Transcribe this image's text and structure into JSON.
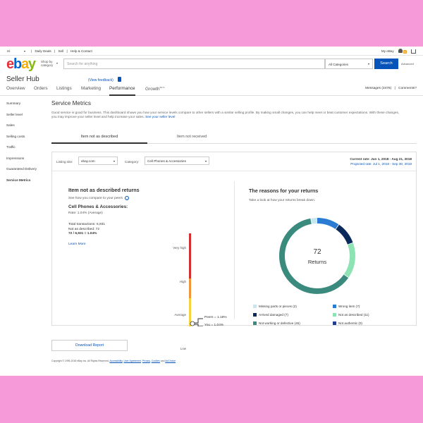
{
  "topbar": {
    "greeting": "Hi",
    "links": [
      "Daily Deals",
      "Sell",
      "Help & Contact"
    ],
    "separator": "|",
    "my_ebay": "My eBay",
    "notifications_count": "5"
  },
  "header": {
    "logo": {
      "e": "e",
      "b": "b",
      "a": "a",
      "y": "y"
    },
    "shop_by": "Shop by category",
    "search_placeholder": "Search for anything",
    "category_value": "All Categories",
    "search_button": "Search",
    "advanced": "Advanced"
  },
  "hub": {
    "title": "Seller Hub",
    "feedback": "(View feedback)",
    "nav": [
      "Overview",
      "Orders",
      "Listings",
      "Marketing",
      "Performance",
      "Growth"
    ],
    "growth_badge": "BETA",
    "messages": "Messages (3476)",
    "comments": "Comments?"
  },
  "sidebar": [
    "Summary",
    "Seller level",
    "Sales",
    "Selling costs",
    "Traffic",
    "Impressions",
    "Guaranteed Delivery",
    "Service Metrics"
  ],
  "main": {
    "title": "Service Metrics",
    "description": "Good service is good for business. This dashboard shows you how your service levels compare to other sellers with a similar selling profile. By making small changes, you can help meet or beat customer expectations. With these changes, you may improve your seller level and help increase your sales.",
    "description_link": "See your seller level",
    "tabs": [
      "Item not as described",
      "Item not received"
    ]
  },
  "filters": {
    "listing_site_label": "Listing site:",
    "listing_site_value": "ebay.com",
    "category_label": "Category:",
    "category_value": "Cell Phones & Accessories",
    "current_rate": "Current rate: Jun 1, 2018 - Aug 21, 2018",
    "projected_rate": "Projected rate: Jul 1, 2018 - Sep 30, 2018"
  },
  "returns": {
    "title": "Item not as described returns",
    "subtitle": "See how you compare to your peers",
    "category": "Cell Phones & Accessories:",
    "rate": "Rate: 1.04% (Average)",
    "total": "Total transactions: 6,931",
    "not_described": "Not as described: 72",
    "ratio": "72 / 6,931 = 1.04%",
    "learn_more": "Learn More",
    "scale": [
      "Very high",
      "High",
      "Average",
      "Low"
    ],
    "peers": "Peers = 1.18%",
    "you": "You = 1.04%",
    "scale_colors": {
      "very_high": "#d32f2f",
      "high": "#f0953a",
      "average": "#f5d33f",
      "low": "#5cb85c"
    }
  },
  "reasons": {
    "title": "The reasons for your returns",
    "subtitle": "Take a look at how your returns break down.",
    "total": "72",
    "total_label": "Returns",
    "items": [
      {
        "label": "Missing parts or pieces (2)",
        "value": 2,
        "color": "#c9e6f0"
      },
      {
        "label": "Wrong item (7)",
        "value": 7,
        "color": "#2a7bd4"
      },
      {
        "label": "Arrived damaged (7)",
        "value": 7,
        "color": "#0b2a5c"
      },
      {
        "label": "Not as described (11)",
        "value": 11,
        "color": "#8ee3b4"
      },
      {
        "label": "Not working or defective (45)",
        "value": 45,
        "color": "#3a8a7e"
      },
      {
        "label": "Not authentic (0)",
        "value": 0,
        "color": "#263c8f"
      }
    ]
  },
  "footer": {
    "copyright": "Copyright © 1995-2018 eBay Inc. All Rights Reserved.",
    "links": [
      "Accessibility",
      "User Agreement",
      "Privacy",
      "Cookies",
      "AdChoice"
    ]
  },
  "download": "Download Report"
}
